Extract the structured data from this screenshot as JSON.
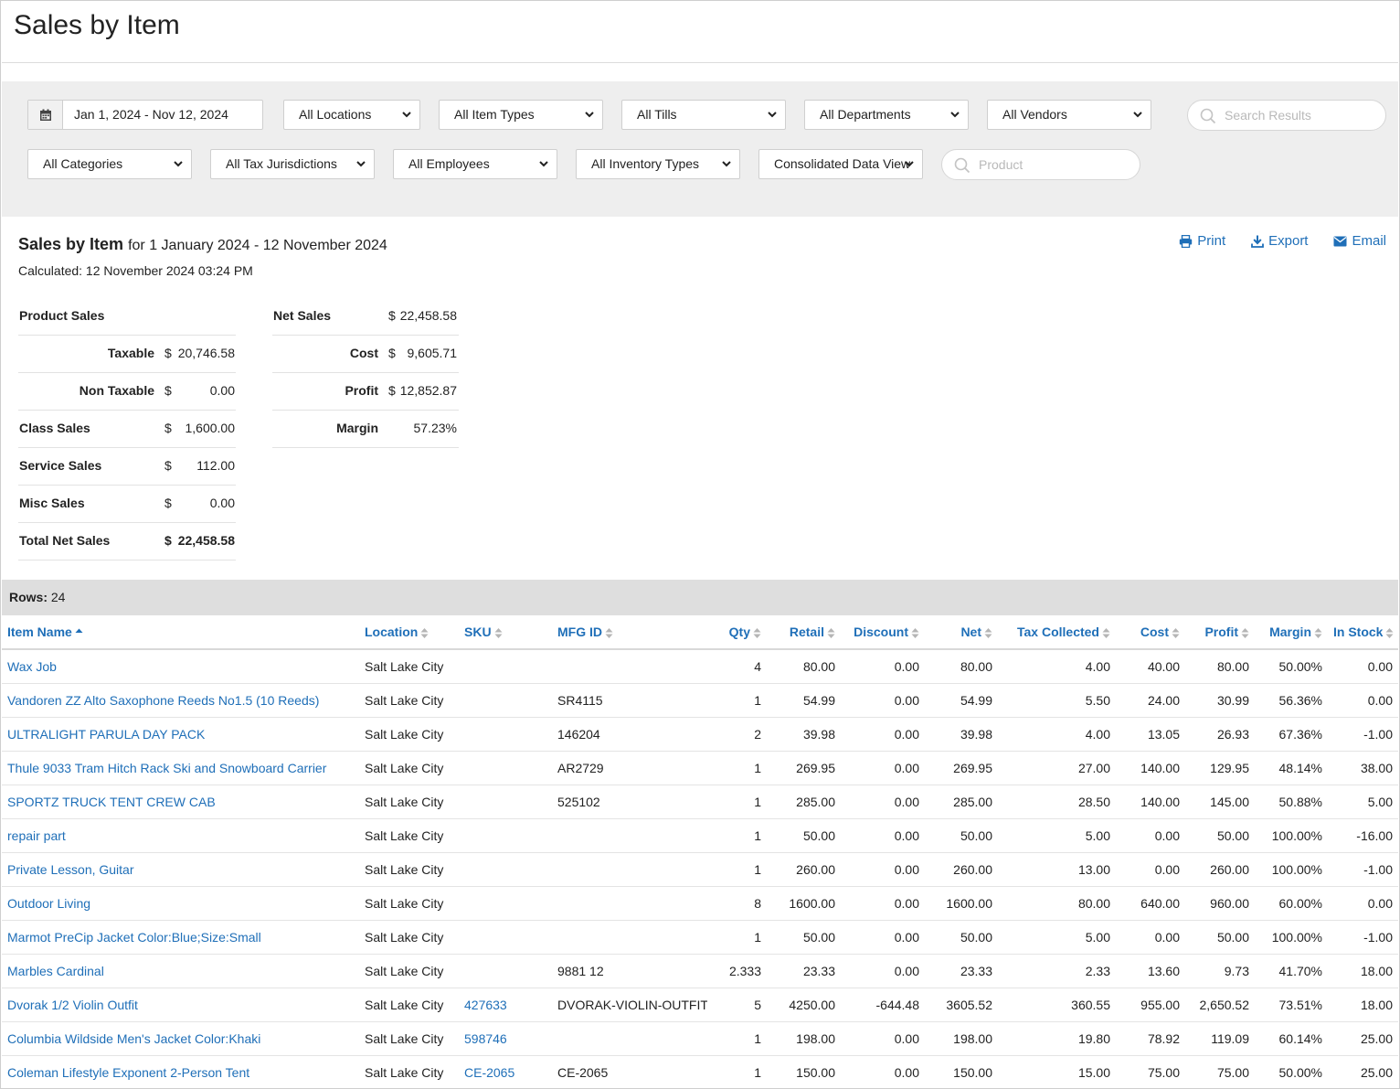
{
  "page": {
    "title": "Sales by Item"
  },
  "filters": {
    "date_range": "Jan 1, 2024 - Nov 12, 2024",
    "row1": [
      "All Locations",
      "All Item Types",
      "All Tills",
      "All Departments",
      "All Vendors"
    ],
    "search_placeholder": "Search Results",
    "row2": [
      "All Categories",
      "All Tax Jurisdictions",
      "All Employees",
      "All Inventory Types",
      "Consolidated Data View"
    ],
    "product_placeholder": "Product"
  },
  "report": {
    "title": "Sales by Item",
    "period": "for 1 January 2024 - 12 November 2024",
    "calculated": "Calculated: 12 November 2024 03:24 PM",
    "actions": {
      "print": "Print",
      "export": "Export",
      "email": "Email"
    }
  },
  "summary_left": [
    {
      "label": "Product Sales",
      "currency": "",
      "value": "",
      "indent": false,
      "bold_value": false
    },
    {
      "label": "Taxable",
      "currency": "$",
      "value": "20,746.58",
      "indent": true,
      "bold_value": false
    },
    {
      "label": "Non Taxable",
      "currency": "$",
      "value": "0.00",
      "indent": true,
      "bold_value": false
    },
    {
      "label": "Class Sales",
      "currency": "$",
      "value": "1,600.00",
      "indent": false,
      "bold_value": false
    },
    {
      "label": "Service Sales",
      "currency": "$",
      "value": "112.00",
      "indent": false,
      "bold_value": false
    },
    {
      "label": "Misc Sales",
      "currency": "$",
      "value": "0.00",
      "indent": false,
      "bold_value": false
    },
    {
      "label": "Total Net Sales",
      "currency": "$",
      "value": "22,458.58",
      "indent": false,
      "bold_value": true
    }
  ],
  "summary_right": [
    {
      "label": "Net Sales",
      "currency": "$",
      "value": "22,458.58",
      "indent": false
    },
    {
      "label": "Cost",
      "currency": "$",
      "value": "9,605.71",
      "indent": true
    },
    {
      "label": "Profit",
      "currency": "$",
      "value": "12,852.87",
      "indent": true
    },
    {
      "label": "Margin",
      "currency": "",
      "value": "57.23%",
      "indent": true
    }
  ],
  "rows_label": "Rows:",
  "rows_count": "24",
  "table": {
    "columns": [
      "Item Name",
      "Location",
      "SKU",
      "MFG ID",
      "Qty",
      "Retail",
      "Discount",
      "Net",
      "Tax Collected",
      "Cost",
      "Profit",
      "Margin",
      "In Stock"
    ],
    "rows": [
      [
        "Wax Job",
        "Salt Lake City",
        "",
        "",
        "4",
        "80.00",
        "0.00",
        "80.00",
        "4.00",
        "40.00",
        "80.00",
        "50.00%",
        "0.00"
      ],
      [
        "Vandoren ZZ Alto Saxophone Reeds No1.5 (10 Reeds)",
        "Salt Lake City",
        "",
        "SR4115",
        "1",
        "54.99",
        "0.00",
        "54.99",
        "5.50",
        "24.00",
        "30.99",
        "56.36%",
        "0.00"
      ],
      [
        "ULTRALIGHT PARULA DAY PACK",
        "Salt Lake City",
        "",
        "146204",
        "2",
        "39.98",
        "0.00",
        "39.98",
        "4.00",
        "13.05",
        "26.93",
        "67.36%",
        "-1.00"
      ],
      [
        "Thule 9033 Tram Hitch Rack Ski and Snowboard Carrier",
        "Salt Lake City",
        "",
        "AR2729",
        "1",
        "269.95",
        "0.00",
        "269.95",
        "27.00",
        "140.00",
        "129.95",
        "48.14%",
        "38.00"
      ],
      [
        "SPORTZ TRUCK TENT CREW CAB",
        "Salt Lake City",
        "",
        "525102",
        "1",
        "285.00",
        "0.00",
        "285.00",
        "28.50",
        "140.00",
        "145.00",
        "50.88%",
        "5.00"
      ],
      [
        "repair part",
        "Salt Lake City",
        "",
        "",
        "1",
        "50.00",
        "0.00",
        "50.00",
        "5.00",
        "0.00",
        "50.00",
        "100.00%",
        "-16.00"
      ],
      [
        "Private Lesson, Guitar",
        "Salt Lake City",
        "",
        "",
        "1",
        "260.00",
        "0.00",
        "260.00",
        "13.00",
        "0.00",
        "260.00",
        "100.00%",
        "-1.00"
      ],
      [
        "Outdoor Living",
        "Salt Lake City",
        "",
        "",
        "8",
        "1600.00",
        "0.00",
        "1600.00",
        "80.00",
        "640.00",
        "960.00",
        "60.00%",
        "0.00"
      ],
      [
        "Marmot PreCip Jacket Color:Blue;Size:Small",
        "Salt Lake City",
        "",
        "",
        "1",
        "50.00",
        "0.00",
        "50.00",
        "5.00",
        "0.00",
        "50.00",
        "100.00%",
        "-1.00"
      ],
      [
        "Marbles Cardinal",
        "Salt Lake City",
        "",
        "9881 12",
        "2.333",
        "23.33",
        "0.00",
        "23.33",
        "2.33",
        "13.60",
        "9.73",
        "41.70%",
        "18.00"
      ],
      [
        "Dvorak 1/2 Violin Outfit",
        "Salt Lake City",
        "427633",
        "DVORAK-VIOLIN-OUTFIT",
        "5",
        "4250.00",
        "-644.48",
        "3605.52",
        "360.55",
        "955.00",
        "2,650.52",
        "73.51%",
        "18.00"
      ],
      [
        "Columbia Wildside Men's Jacket Color:Khaki",
        "Salt Lake City",
        "598746",
        "",
        "1",
        "198.00",
        "0.00",
        "198.00",
        "19.80",
        "78.92",
        "119.09",
        "60.14%",
        "25.00"
      ],
      [
        "Coleman Lifestyle Exponent 2-Person Tent",
        "Salt Lake City",
        "CE-2065",
        "CE-2065",
        "1",
        "150.00",
        "0.00",
        "150.00",
        "15.00",
        "75.00",
        "75.00",
        "50.00%",
        "25.00"
      ]
    ]
  },
  "colors": {
    "link": "#1f6fb8",
    "filter_bg": "#eeeeee",
    "rows_bar_bg": "#dedede"
  }
}
